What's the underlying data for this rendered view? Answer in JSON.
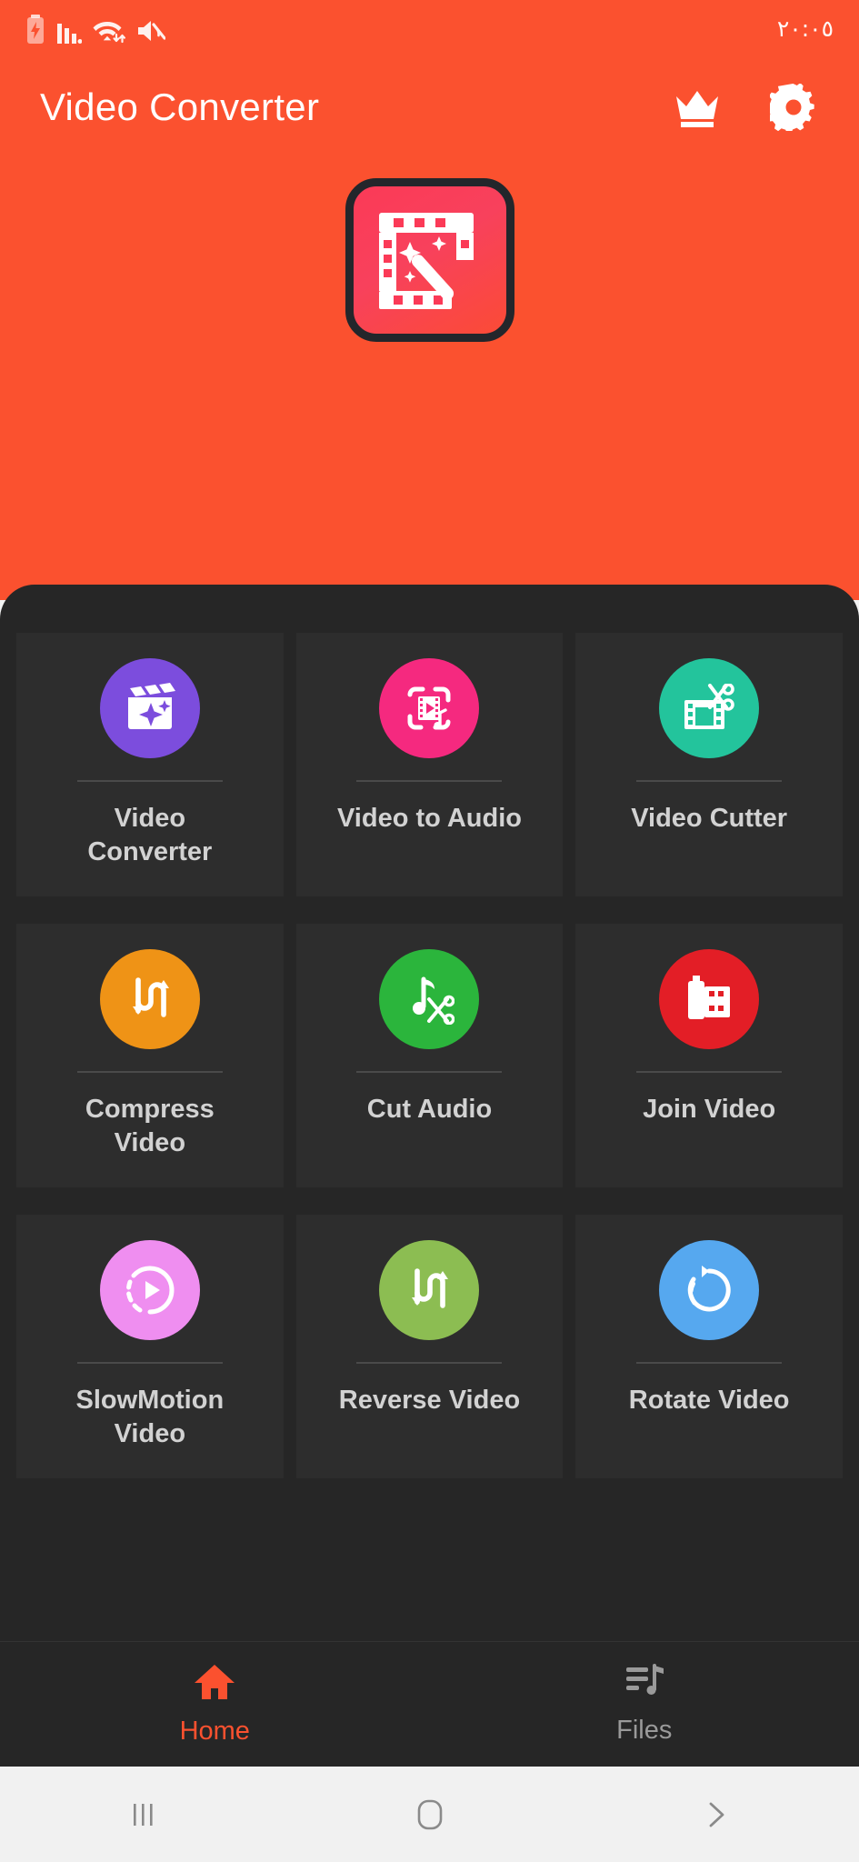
{
  "status_bar": {
    "time": "٢٠:٠٥",
    "icons": [
      "battery-charging-icon",
      "signal-bars-icon",
      "wifi-data-icon",
      "mute-icon"
    ]
  },
  "header": {
    "title": "Video Converter",
    "background_color": "#fb512f",
    "actions": [
      {
        "name": "crown-premium-button",
        "icon": "crown-icon"
      },
      {
        "name": "settings-button",
        "icon": "gear-icon"
      }
    ],
    "hero_icon": {
      "name": "app-logo-icon",
      "icon": "film-strip-magic-wand-icon",
      "background_color": "#fb3a57",
      "border_color": "#23262b"
    }
  },
  "panel": {
    "background_color": "#262626",
    "card_background": "#2d2d2d",
    "tools": [
      {
        "label": "Video\nConverter",
        "label_line1": "Video",
        "label_line2": "Converter",
        "icon": "clapperboard-sparkle-icon",
        "color": "#7c4ddd"
      },
      {
        "label": "Video to Audio",
        "label_line1": "Video to Audio",
        "label_line2": "",
        "icon": "video-to-music-icon",
        "color": "#f5297f"
      },
      {
        "label": "Video Cutter",
        "label_line1": "Video Cutter",
        "label_line2": "",
        "icon": "film-scissors-icon",
        "color": "#23c49c"
      },
      {
        "label": "Compress\nVideo",
        "label_line1": "Compress",
        "label_line2": "Video",
        "icon": "compress-arrows-icon",
        "color": "#ef9316"
      },
      {
        "label": "Cut Audio",
        "label_line1": "Cut Audio",
        "label_line2": "",
        "icon": "music-scissors-icon",
        "color": "#2bb53c"
      },
      {
        "label": "Join Video",
        "label_line1": "Join Video",
        "label_line2": "",
        "icon": "film-canister-icon",
        "color": "#e31e26"
      },
      {
        "label": "SlowMotion\nVideo",
        "label_line1": "SlowMotion",
        "label_line2": "Video",
        "icon": "slow-motion-play-icon",
        "color": "#ef8ef0"
      },
      {
        "label": "Reverse Video",
        "label_line1": "Reverse Video",
        "label_line2": "",
        "icon": "reverse-arrows-icon",
        "color": "#8cbd52"
      },
      {
        "label": "Rotate Video",
        "label_line1": "Rotate Video",
        "label_line2": "",
        "icon": "rotate-arrow-icon",
        "color": "#56a8ef"
      }
    ]
  },
  "tab_bar": {
    "active_color": "#fb512f",
    "inactive_color": "#9a9a9a",
    "tabs": [
      {
        "label": "Home",
        "icon": "home-icon",
        "active": true
      },
      {
        "label": "Files",
        "icon": "files-music-icon",
        "active": false
      }
    ]
  },
  "system_nav": {
    "buttons": [
      {
        "name": "recents-button",
        "icon": "recents-bars-icon"
      },
      {
        "name": "home-button",
        "icon": "home-square-icon"
      },
      {
        "name": "back-button",
        "icon": "chevron-right-icon"
      }
    ]
  }
}
